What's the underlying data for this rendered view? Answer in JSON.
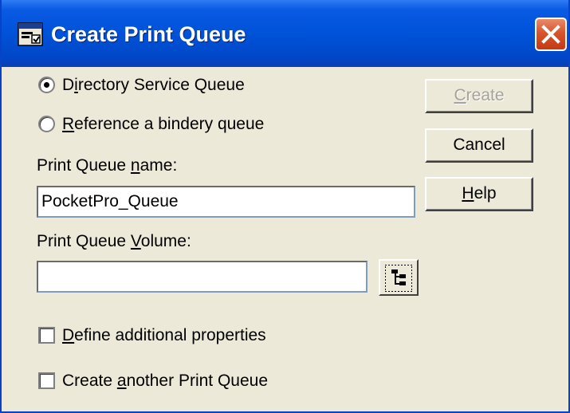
{
  "window": {
    "title": "Create Print Queue",
    "icon": "printer-queue-icon",
    "close_icon": "close-icon"
  },
  "options": {
    "directory_service": {
      "pre": "D",
      "ul": "i",
      "post": "rectory Service Queue",
      "selected": true
    },
    "bindery": {
      "pre": "",
      "ul": "R",
      "post": "eference a bindery queue",
      "selected": false
    }
  },
  "queue_name": {
    "label_pre": "Print Queue ",
    "label_ul": "n",
    "label_post": "ame:",
    "value": "PocketPro_Queue"
  },
  "queue_volume": {
    "label_pre": "Print Queue ",
    "label_ul": "V",
    "label_post": "olume:",
    "value": "",
    "browse_icon": "browse-directory-tree-icon"
  },
  "checkboxes": {
    "define_props": {
      "pre": "",
      "ul": "D",
      "post": "efine additional properties",
      "checked": false
    },
    "create_another": {
      "pre": "Create ",
      "ul": "a",
      "post": "nother Print Queue",
      "checked": false
    }
  },
  "buttons": {
    "create": {
      "ul": "C",
      "post": "reate",
      "enabled": false
    },
    "cancel": {
      "label": "Cancel"
    },
    "help": {
      "ul": "H",
      "post": "elp"
    }
  },
  "colors": {
    "titlebar": "#0052d8",
    "dialog_bg": "#ece9d8",
    "close_button": "#d7542c",
    "disabled_text": "#a6a39a"
  }
}
